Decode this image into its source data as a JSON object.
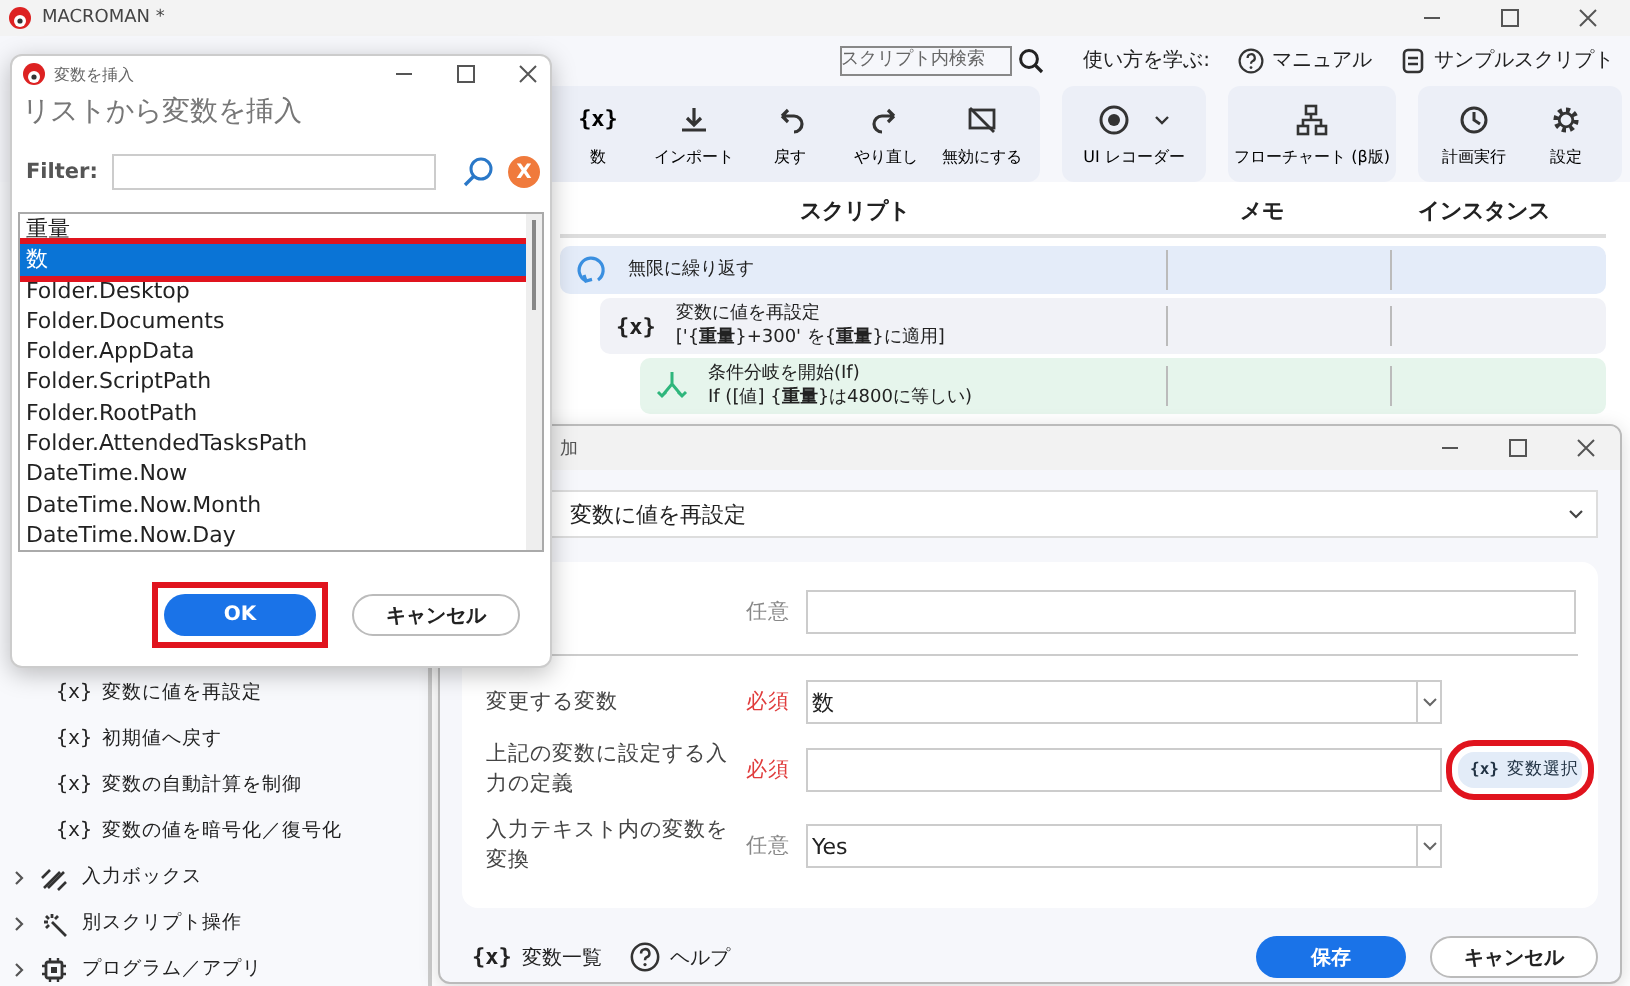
{
  "app": {
    "title": "MACROMAN *"
  },
  "search": {
    "placeholder": "スクリプト内検索"
  },
  "help_links": {
    "label": "使い方を学ぶ:",
    "items": [
      {
        "kind": "manual",
        "label": "マニュアル"
      },
      {
        "kind": "samples",
        "label": "サンプルスクリプト"
      }
    ]
  },
  "toolbar_groups": [
    {
      "items": [
        {
          "kind": "variable",
          "icon_text": "{x}",
          "label": "数",
          "has_menu": false
        },
        {
          "kind": "import",
          "label": "インポート",
          "has_menu": false
        },
        {
          "kind": "undo",
          "label": "戻す",
          "has_menu": false
        },
        {
          "kind": "redo",
          "label": "やり直し",
          "has_menu": false
        },
        {
          "kind": "disable",
          "label": "無効にする",
          "has_menu": false
        }
      ]
    },
    {
      "items": [
        {
          "kind": "record",
          "label": "UI レコーダー",
          "has_menu": true
        }
      ]
    },
    {
      "items": [
        {
          "kind": "flowchart",
          "label": "フローチャート (β版)",
          "has_menu": false
        }
      ]
    },
    {
      "items": [
        {
          "kind": "schedule",
          "label": "計画実行",
          "has_menu": false
        },
        {
          "kind": "settings",
          "label": "設定",
          "has_menu": false
        }
      ]
    }
  ],
  "script_table": {
    "columns": [
      "スクリプト",
      "メモ",
      "インスタンス"
    ],
    "rows": [
      {
        "kind": "loop",
        "title": "無限に繰り返す",
        "children": [
          {
            "kind": "variable",
            "icon_text": "{x}",
            "title": "変数に値を再設定",
            "detail": "['{**重量**}+300' を{**重量**}に適用]",
            "children": [
              {
                "kind": "if",
                "title": "条件分岐を開始(If)",
                "detail": "If ([値] {**重量**}は4800に等しい)"
              }
            ]
          }
        ]
      }
    ]
  },
  "sidebar": {
    "items": [
      {
        "kind": "action",
        "icon_text": "{x}",
        "label": "変数に値を再設定"
      },
      {
        "kind": "action",
        "icon_text": "{x}",
        "label": "初期値へ戻す"
      },
      {
        "kind": "action",
        "icon_text": "{x}",
        "label": "変数の自動計算を制御"
      },
      {
        "kind": "action",
        "icon_text": "{x}",
        "label": "変数の値を暗号化／復号化"
      },
      {
        "kind": "input",
        "label": "入力ボックス",
        "expanded": false
      },
      {
        "kind": "script",
        "label": "別スクリプト操作",
        "expanded": false
      },
      {
        "kind": "program",
        "label": "プログラム／アプリ",
        "expanded": false
      }
    ]
  },
  "edit_dialog": {
    "title": "加",
    "action": "変数に値を再設定",
    "fields": [
      {
        "kind": "text",
        "requirement": "任意",
        "required": false,
        "divider_after": true
      },
      {
        "kind": "select",
        "label": "変更する変数",
        "requirement": "必須",
        "required": true,
        "value": "数",
        "divider_after": false
      },
      {
        "kind": "text",
        "label": "上記の変数に設定する入力の定義",
        "requirement": "必須",
        "required": true,
        "divider_after": false,
        "button": {
          "icon_text": "{x}",
          "label": "変数選択",
          "highlighted": true
        }
      },
      {
        "kind": "select",
        "label": "入力テキスト内の変数を変換",
        "requirement": "任意",
        "required": false,
        "value": "Yes",
        "divider_after": false
      }
    ],
    "footer_links": [
      {
        "kind": "variables",
        "icon_text": "{x}",
        "label": "変数一覧"
      },
      {
        "kind": "help",
        "label": "ヘルプ"
      }
    ],
    "buttons": [
      {
        "kind": "primary",
        "label": "保存"
      },
      {
        "kind": "secondary",
        "label": "キャンセル"
      }
    ]
  },
  "insert_dialog": {
    "title": "変数を挿入",
    "heading": "リストから変数を挿入",
    "filter": {
      "label": "Filter:"
    },
    "clear_label": "X",
    "items": [
      {
        "label": "重量",
        "selected": false,
        "highlighted": false
      },
      {
        "label": "数",
        "selected": true,
        "highlighted": true
      },
      {
        "label": "Folder.Desktop",
        "selected": false,
        "highlighted": false
      },
      {
        "label": "Folder.Documents",
        "selected": false,
        "highlighted": false
      },
      {
        "label": "Folder.AppData",
        "selected": false,
        "highlighted": false
      },
      {
        "label": "Folder.ScriptPath",
        "selected": false,
        "highlighted": false
      },
      {
        "label": "Folder.RootPath",
        "selected": false,
        "highlighted": false
      },
      {
        "label": "Folder.AttendedTasksPath",
        "selected": false,
        "highlighted": false
      },
      {
        "label": "DateTime.Now",
        "selected": false,
        "highlighted": false
      },
      {
        "label": "DateTime.Now.Month",
        "selected": false,
        "highlighted": false
      },
      {
        "label": "DateTime.Now.Day",
        "selected": false,
        "highlighted": false
      }
    ],
    "buttons": [
      {
        "kind": "primary",
        "label": "OK",
        "highlighted": true
      },
      {
        "kind": "secondary",
        "label": "キャンセル",
        "highlighted": false
      }
    ]
  }
}
